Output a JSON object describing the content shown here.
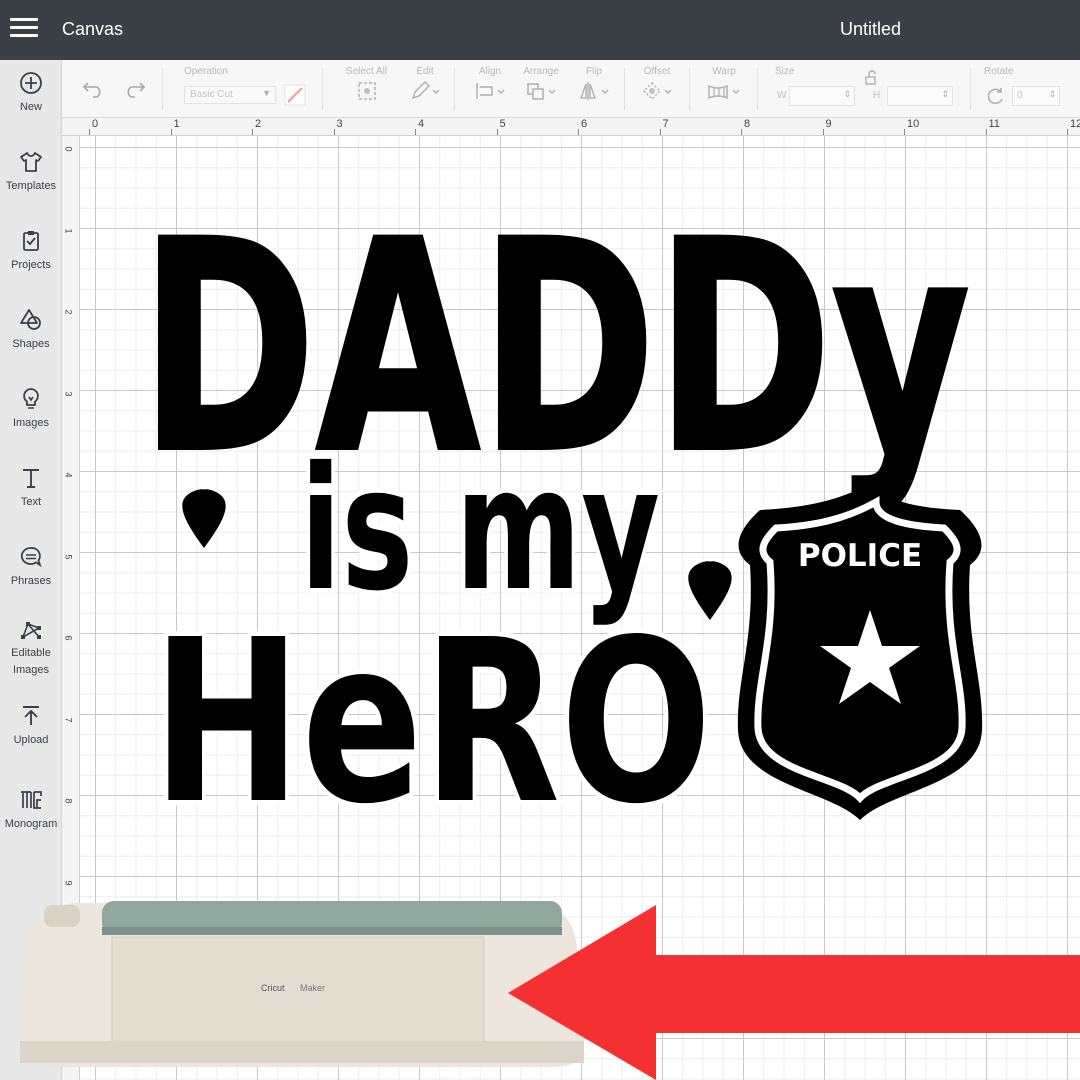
{
  "header": {
    "app_title": "Canvas",
    "document_title": "Untitled"
  },
  "sidebar": {
    "items": [
      {
        "label": "New",
        "icon": "plus-circle-icon"
      },
      {
        "label": "Templates",
        "icon": "shirt-icon"
      },
      {
        "label": "Projects",
        "icon": "projects-icon"
      },
      {
        "label": "Shapes",
        "icon": "shapes-icon"
      },
      {
        "label": "Images",
        "icon": "lightbulb-icon"
      },
      {
        "label": "Text",
        "icon": "text-icon"
      },
      {
        "label": "Phrases",
        "icon": "speech-bubble-icon"
      },
      {
        "label": "Editable Images",
        "icon": "editable-images-icon"
      },
      {
        "label": "Upload",
        "icon": "upload-icon"
      },
      {
        "label": "Monogram",
        "icon": "monogram-icon"
      }
    ]
  },
  "toolbar": {
    "operation_label": "Operation",
    "operation_value": "Basic Cut",
    "select_all_label": "Select All",
    "edit_label": "Edit",
    "align_label": "Align",
    "arrange_label": "Arrange",
    "flip_label": "Flip",
    "offset_label": "Offset",
    "warp_label": "Warp",
    "size_label": "Size",
    "width_prefix": "W",
    "height_prefix": "H",
    "rotate_label": "Rotate",
    "rotate_value": "0"
  },
  "ruler": {
    "horizontal": [
      "0",
      "1",
      "2",
      "3",
      "4",
      "5",
      "6",
      "7",
      "8",
      "9",
      "10",
      "11",
      "12"
    ],
    "vertical": [
      "0",
      "1",
      "2",
      "3",
      "4",
      "5",
      "6",
      "7",
      "8",
      "9"
    ]
  },
  "design": {
    "line1": "DADDy",
    "line2": "is my",
    "line3": "HeRO",
    "badge_text": "POLICE"
  },
  "machine": {
    "brand": "Cricut",
    "model": "Maker"
  },
  "colors": {
    "topbar": "#3b4047",
    "sidebar": "#e8e8e8",
    "arrow": "#f53033",
    "machine_body": "#ece6dc",
    "machine_lid": "#8fa79c",
    "ink": "#000000"
  }
}
